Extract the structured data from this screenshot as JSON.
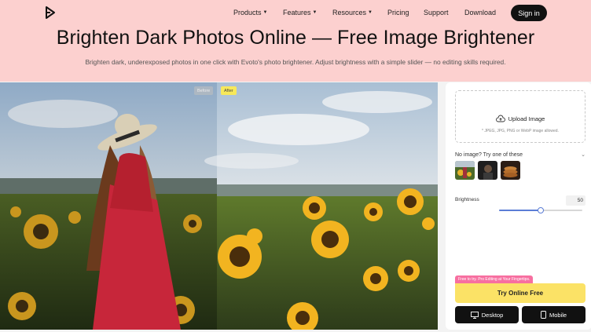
{
  "nav": {
    "items": [
      {
        "label": "Products",
        "has_caret": true
      },
      {
        "label": "Features",
        "has_caret": true
      },
      {
        "label": "Resources",
        "has_caret": true
      },
      {
        "label": "Pricing",
        "has_caret": false
      },
      {
        "label": "Support",
        "has_caret": false
      },
      {
        "label": "Download",
        "has_caret": false
      }
    ],
    "signin_label": "Sign in",
    "logo_icon": "evoto-logo-icon"
  },
  "hero": {
    "title": "Brighten Dark Photos Online — Free Image Brightener",
    "subtitle": "Brighten dark, underexposed photos in one click with Evoto's photo brightener. Adjust brightness with a simple slider — no editing skills required.",
    "background": "#fcd0cf"
  },
  "preview": {
    "before_label": "Before",
    "after_label": "After"
  },
  "panel": {
    "upload_label": "Upload Image",
    "upload_hint": "* JPEG, JPG, PNG or WebP image allowed.",
    "upload_icon": "cloud-upload-icon",
    "sample_prompt": "No image? Try one of these",
    "samples": [
      "sample-flowers",
      "sample-dark-portrait",
      "sample-pancakes"
    ],
    "brightness_label": "Brightness",
    "brightness_value": "50",
    "brightness_fraction": 0.5,
    "promo_label": "Free to try. Pro Editing at Your Fingertips.",
    "try_label": "Try Online Free",
    "desktop_label": "Desktop",
    "mobile_label": "Mobile",
    "accent": "#fbe266",
    "promo_color": "#f76fa0"
  }
}
